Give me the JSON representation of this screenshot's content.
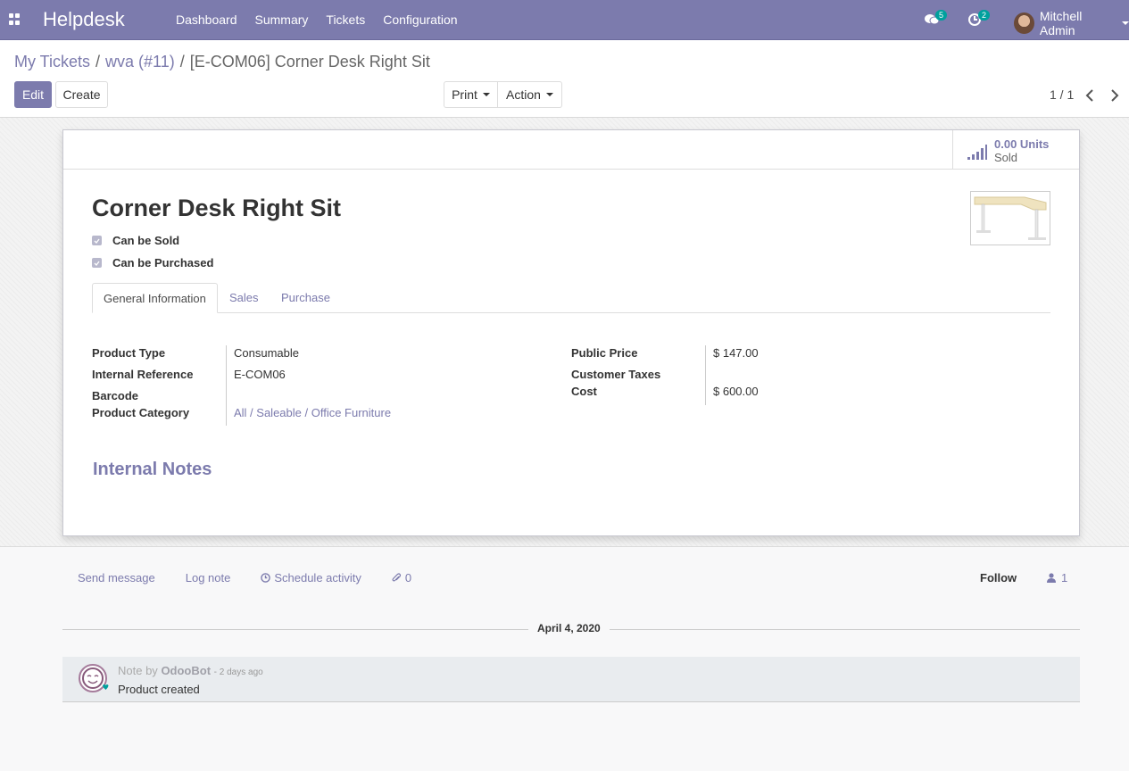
{
  "navbar": {
    "brand": "Helpdesk",
    "menu": [
      "Dashboard",
      "Summary",
      "Tickets",
      "Configuration"
    ],
    "messages_count": "5",
    "activities_count": "2",
    "user_name": "Mitchell Admin"
  },
  "breadcrumb": {
    "items": [
      "My Tickets",
      "wva (#11)"
    ],
    "current": "[E-COM06] Corner Desk Right Sit",
    "separator": "/"
  },
  "buttons": {
    "edit": "Edit",
    "create": "Create",
    "print": "Print",
    "action": "Action"
  },
  "pager": "1 / 1",
  "stat": {
    "value": "0.00 Units",
    "label": "Sold"
  },
  "product": {
    "name": "Corner Desk Right Sit",
    "can_be_sold": "Can be Sold",
    "can_be_purchased": "Can be Purchased"
  },
  "tabs": [
    "General Information",
    "Sales",
    "Purchase"
  ],
  "general": {
    "left": [
      {
        "label": "Product Type",
        "value": "Consumable"
      },
      {
        "label": "Internal Reference",
        "value": "E-COM06"
      },
      {
        "label": "Barcode",
        "value": ""
      },
      {
        "label": "Product Category",
        "value": "All / Saleable / Office Furniture"
      }
    ],
    "right": [
      {
        "label": "Public Price",
        "value": "$ 147.00"
      },
      {
        "label": "Customer Taxes",
        "value": ""
      },
      {
        "label": "Cost",
        "value": "$ 600.00"
      }
    ]
  },
  "internal_notes": "Internal Notes",
  "chatter": {
    "send_message": "Send message",
    "log_note": "Log note",
    "schedule_activity": "Schedule activity",
    "attachments": "0",
    "follow": "Follow",
    "followers": "1",
    "date": "April 4, 2020",
    "message": {
      "prefix": "Note by",
      "author": "OdooBot",
      "time": "- 2 days ago",
      "body": "Product created"
    }
  },
  "colors": {
    "brand": "#7c7bad",
    "badge": "#00a09d"
  }
}
